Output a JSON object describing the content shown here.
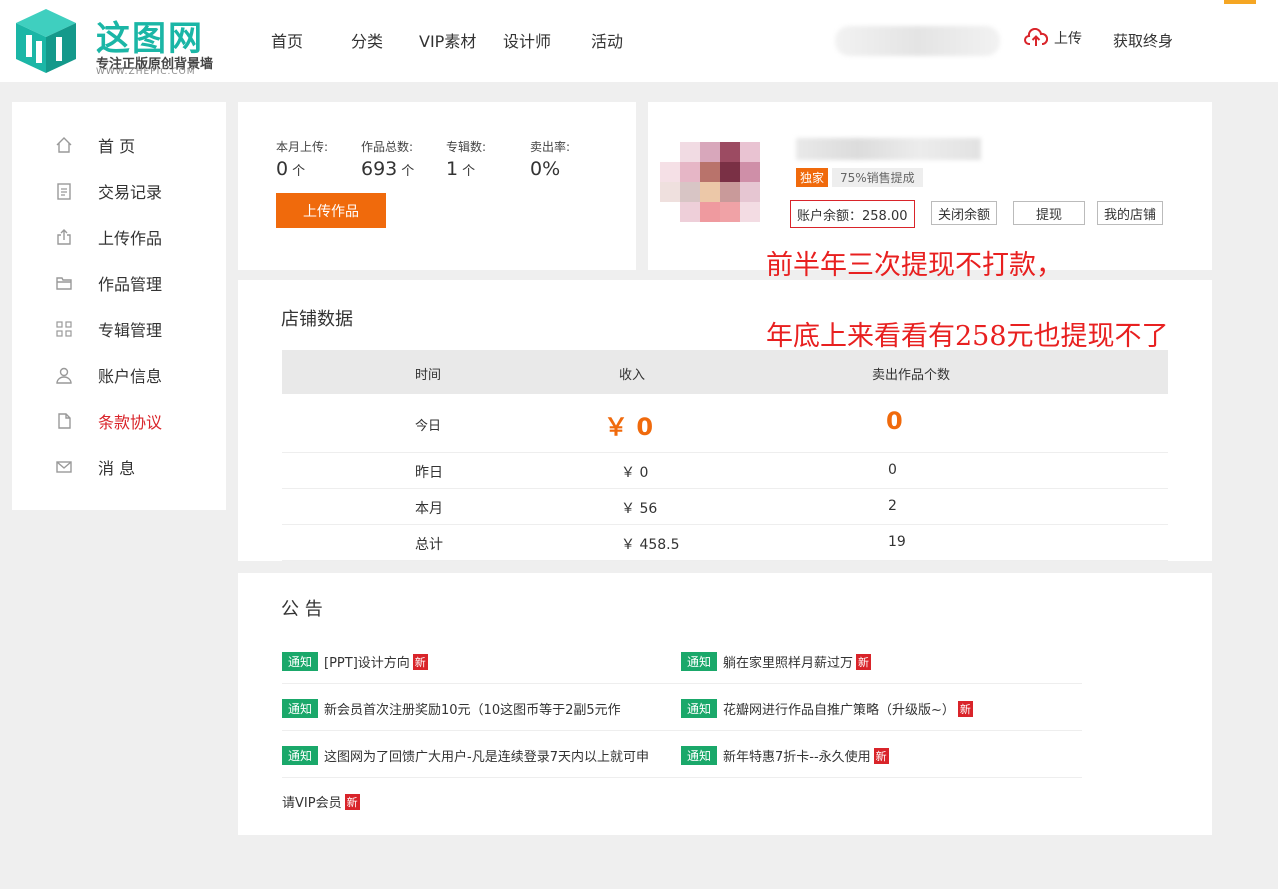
{
  "header": {
    "logo_text": "这图网",
    "logo_slogan": "专注正版原创背景墙",
    "logo_url": "WWW.ZHEPIC.COM",
    "nav": [
      "首页",
      "分类",
      "VIP素材",
      "设计师",
      "活动"
    ],
    "upload_label": "上传",
    "lifetime_label": "获取终身"
  },
  "sidebar": {
    "items": [
      {
        "label": "首 页",
        "icon": "home-icon"
      },
      {
        "label": "交易记录",
        "icon": "clipboard-icon"
      },
      {
        "label": "上传作品",
        "icon": "upload-icon"
      },
      {
        "label": "作品管理",
        "icon": "folder-icon"
      },
      {
        "label": "专辑管理",
        "icon": "grid-icon"
      },
      {
        "label": "账户信息",
        "icon": "user-icon"
      },
      {
        "label": "条款协议",
        "icon": "document-icon"
      },
      {
        "label": "消 息",
        "icon": "mail-icon"
      }
    ]
  },
  "stats": {
    "items": [
      {
        "label": "本月上传:",
        "value": "0",
        "unit": "个"
      },
      {
        "label": "作品总数:",
        "value": "693",
        "unit": "个"
      },
      {
        "label": "专辑数:",
        "value": "1",
        "unit": "个"
      },
      {
        "label": "卖出率:",
        "value": "0%",
        "unit": ""
      }
    ],
    "upload_button": "上传作品"
  },
  "profile": {
    "tag_exclusive": "独家",
    "tag_rate": "75%销售提成",
    "balance": "账户余额：258.00",
    "buttons": [
      "关闭余额",
      "提现",
      "我的店铺"
    ]
  },
  "annotation": {
    "line1": "前半年三次提现不打款，",
    "line2": "年底上来看看有258元也提现不了"
  },
  "store": {
    "title": "店铺数据",
    "headers": [
      "时间",
      "收入",
      "卖出作品个数"
    ],
    "rows": [
      {
        "time": "今日",
        "income": "￥ 0",
        "count": "0"
      },
      {
        "time": "昨日",
        "income": "￥ 0",
        "count": "0"
      },
      {
        "time": "本月",
        "income": "￥ 56",
        "count": "2"
      },
      {
        "time": "总计",
        "income": "￥ 458.5",
        "count": "19"
      }
    ]
  },
  "notice": {
    "title": "公 告",
    "tag": "通知",
    "new_label": "新",
    "items": [
      "[PPT]设计方向",
      "躺在家里照样月薪过万",
      "新会员首次注册奖励10元（10这图币等于2副5元作",
      "花瓣网进行作品自推广策略（升级版~）",
      "这图网为了回馈广大用户-凡是连续登录7天内以上就可申",
      "新年特惠7折卡--永久使用",
      "请VIP会员"
    ]
  },
  "colors": {
    "accent": "#f06a0c",
    "danger": "#d9242a",
    "brand": "#1bb6a6",
    "notice_tag": "#1aa86a"
  }
}
